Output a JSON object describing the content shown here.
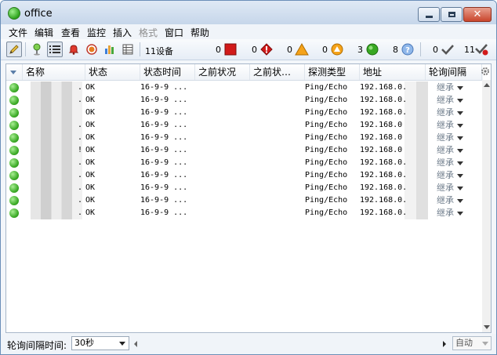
{
  "window": {
    "title": "office"
  },
  "menu": [
    "文件",
    "编辑",
    "查看",
    "监控",
    "插入",
    "格式",
    "窗口",
    "帮助"
  ],
  "toolbar": {
    "device_count": "11设备",
    "counts": {
      "red_square": "0",
      "red_alert": "0",
      "warning": "0",
      "orange_alert": "0",
      "ok": "3",
      "unknown": "8",
      "ack": "0",
      "unack": "11"
    }
  },
  "table": {
    "columns": [
      "名称",
      "状态",
      "状态时间",
      "之前状况",
      "之前状…",
      "探测类型",
      "地址",
      "轮询间隔"
    ],
    "rows": [
      {
        "name": ".",
        "status": "OK",
        "time": "16-9-9 ...",
        "prev": "",
        "prev2": "",
        "probe": "Ping/Echo",
        "addr": "192.168.0.",
        "interval": "继承"
      },
      {
        "name": ".",
        "status": "OK",
        "time": "16-9-9 ...",
        "prev": "",
        "prev2": "",
        "probe": "Ping/Echo",
        "addr": "192.168.0.",
        "interval": "继承"
      },
      {
        "name": "",
        "status": "OK",
        "time": "16-9-9 ...",
        "prev": "",
        "prev2": "",
        "probe": "Ping/Echo",
        "addr": "192.168.0.",
        "interval": "继承"
      },
      {
        "name": ".",
        "status": "OK",
        "time": "16-9-9 ...",
        "prev": "",
        "prev2": "",
        "probe": "Ping/Echo",
        "addr": "192.168.0",
        "interval": "继承"
      },
      {
        "name": ".",
        "status": "OK",
        "time": "16-9-9 ...",
        "prev": "",
        "prev2": "",
        "probe": "Ping/Echo",
        "addr": "192.168.0",
        "interval": "继承"
      },
      {
        "name": "!",
        "status": "OK",
        "time": "16-9-9 ...",
        "prev": "",
        "prev2": "",
        "probe": "Ping/Echo",
        "addr": "192.168.0",
        "interval": "继承"
      },
      {
        "name": ".",
        "status": "OK",
        "time": "16-9-9 ...",
        "prev": "",
        "prev2": "",
        "probe": "Ping/Echo",
        "addr": "192.168.0.",
        "interval": "继承"
      },
      {
        "name": ".",
        "status": "OK",
        "time": "16-9-9 ...",
        "prev": "",
        "prev2": "",
        "probe": "Ping/Echo",
        "addr": "192.168.0.",
        "interval": "继承"
      },
      {
        "name": ".",
        "status": "OK",
        "time": "16-9-9 ...",
        "prev": "",
        "prev2": "",
        "probe": "Ping/Echo",
        "addr": "192.168.0.",
        "interval": "继承"
      },
      {
        "name": ".",
        "status": "OK",
        "time": "16-9-9 ...",
        "prev": "",
        "prev2": "",
        "probe": "Ping/Echo",
        "addr": "192.168.0.",
        "interval": "继承"
      },
      {
        "name": ".",
        "status": "OK",
        "time": "16-9-9 ...",
        "prev": "",
        "prev2": "",
        "probe": "Ping/Echo",
        "addr": "192.168.0.",
        "interval": "继承"
      }
    ]
  },
  "status": {
    "label": "轮询间隔时间:",
    "interval_value": "30秒",
    "auto": "自动"
  },
  "colors": {
    "ok_green": "#38a823",
    "alert_red": "#d11a1a",
    "warning_orange": "#f5a31a",
    "unknown_blue": "#5b8fd6"
  }
}
